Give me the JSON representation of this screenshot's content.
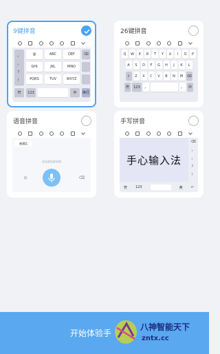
{
  "cards": {
    "nine_key": {
      "title": "9键拼音",
      "selected": true,
      "keys": {
        "row1": [
          "，",
          "@",
          "ABC",
          "DEF"
        ],
        "row2": [
          "。",
          "GHI",
          "JKL",
          "MNO"
        ],
        "row3": [
          "？",
          "PQRS",
          "TUV",
          "WXYZ"
        ],
        "row4": [
          "符",
          "123",
          "",
          "中",
          "换行"
        ],
        "space_label": "空格",
        "left_col_extra": "！"
      }
    },
    "full_key": {
      "title": "26键拼音",
      "selected": false,
      "row1": [
        "Q",
        "W",
        "E",
        "R",
        "T",
        "Y",
        "U",
        "I",
        "O",
        "P"
      ],
      "row2": [
        "A",
        "S",
        "D",
        "F",
        "G",
        "H",
        "J",
        "K",
        "L"
      ],
      "row3": [
        "Z",
        "X",
        "C",
        "V",
        "B",
        "N",
        "M"
      ],
      "row4": [
        "符",
        "123",
        "，",
        "",
        "。",
        "中"
      ]
    },
    "voice": {
      "title": "语音拼音",
      "selected": false,
      "mode_label": "普通话",
      "hint": "点击说话或长按",
      "left_side": "⊙",
      "right_side": "⌫"
    },
    "handwriting": {
      "title": "手写拼音",
      "selected": false,
      "sample": "手心输入法",
      "side_keys": [
        "⌫",
        "，",
        "。",
        "？",
        "！"
      ],
      "bottom_keys": [
        "符",
        "123",
        "",
        "英",
        "↵"
      ]
    }
  },
  "footer": {
    "button_label": "开始体验手",
    "watermark_cn": "八神智能天下",
    "watermark_url": "zntx.cc"
  },
  "colors": {
    "accent": "#4aa3f3",
    "footer_bg": "#59a8f0",
    "page_bg": "#f1f2f6"
  }
}
